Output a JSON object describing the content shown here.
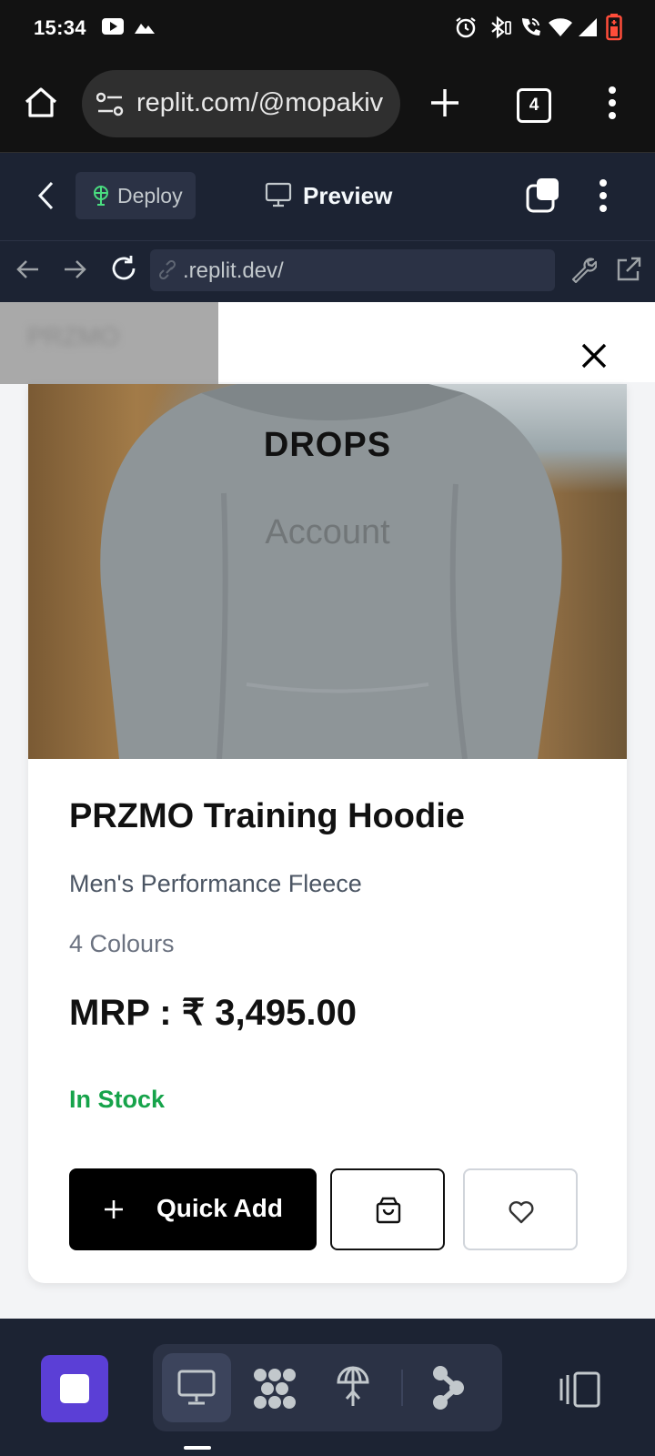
{
  "status_bar": {
    "time": "15:34",
    "icons": [
      "youtube-icon",
      "photos-icon",
      "alarm-icon",
      "bluetooth-icon",
      "wifi-calling-icon",
      "wifi-icon",
      "signal-icon",
      "battery-icon"
    ]
  },
  "browser": {
    "url": "replit.com/@mopakiv",
    "tab_count": "4",
    "icons": [
      "home-icon",
      "site-info-icon",
      "new-tab-icon",
      "tabs-icon",
      "menu-icon"
    ]
  },
  "replit_header": {
    "deploy_label": "Deploy",
    "preview_label": "Preview"
  },
  "webview": {
    "address": ".replit.dev/"
  },
  "page": {
    "blurred_text": "PRZMO",
    "overlay_title": "DROPS",
    "overlay_link": "Account",
    "product": {
      "title": "PRZMO Training Hoodie",
      "subtitle": "Men's Performance Fleece",
      "colours": "4 Colours",
      "price": "MRP : ₹ 3,495.00",
      "stock": "In Stock",
      "quick_add_label": "Quick Add"
    }
  },
  "colors": {
    "replit_bg": "#1c2333",
    "accent_purple": "#5b3fd6",
    "stock_green": "#16a34a"
  }
}
